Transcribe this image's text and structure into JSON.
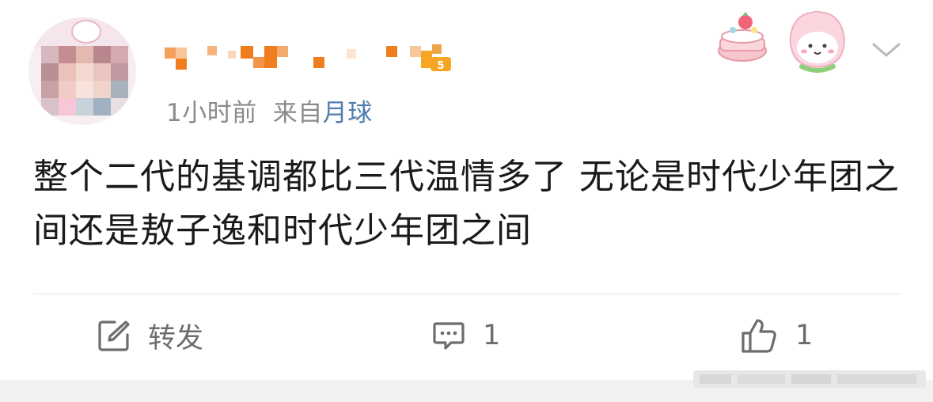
{
  "post": {
    "time": "1小时前",
    "source_prefix": "来自",
    "source": "月球",
    "content": "整个二代的基调都比三代温情多了 无论是时代少年团之间还是敖子逸和时代少年团之间"
  },
  "actions": {
    "repost_label": "转发",
    "comment_count": "1",
    "like_count": "1"
  },
  "user": {
    "level_badge": "5"
  },
  "icons": {
    "repost": "edit-square-icon",
    "comment": "comment-bubble-icon",
    "like": "thumbs-up-icon",
    "menu": "chevron-down-icon"
  },
  "colors": {
    "source_link": "#507daf",
    "meta_text": "#8a8a8a",
    "action_text": "#6d6d6d",
    "body_text": "#1a1a1a",
    "username_blur": "#f07d1e",
    "badge": "#f5a623"
  }
}
